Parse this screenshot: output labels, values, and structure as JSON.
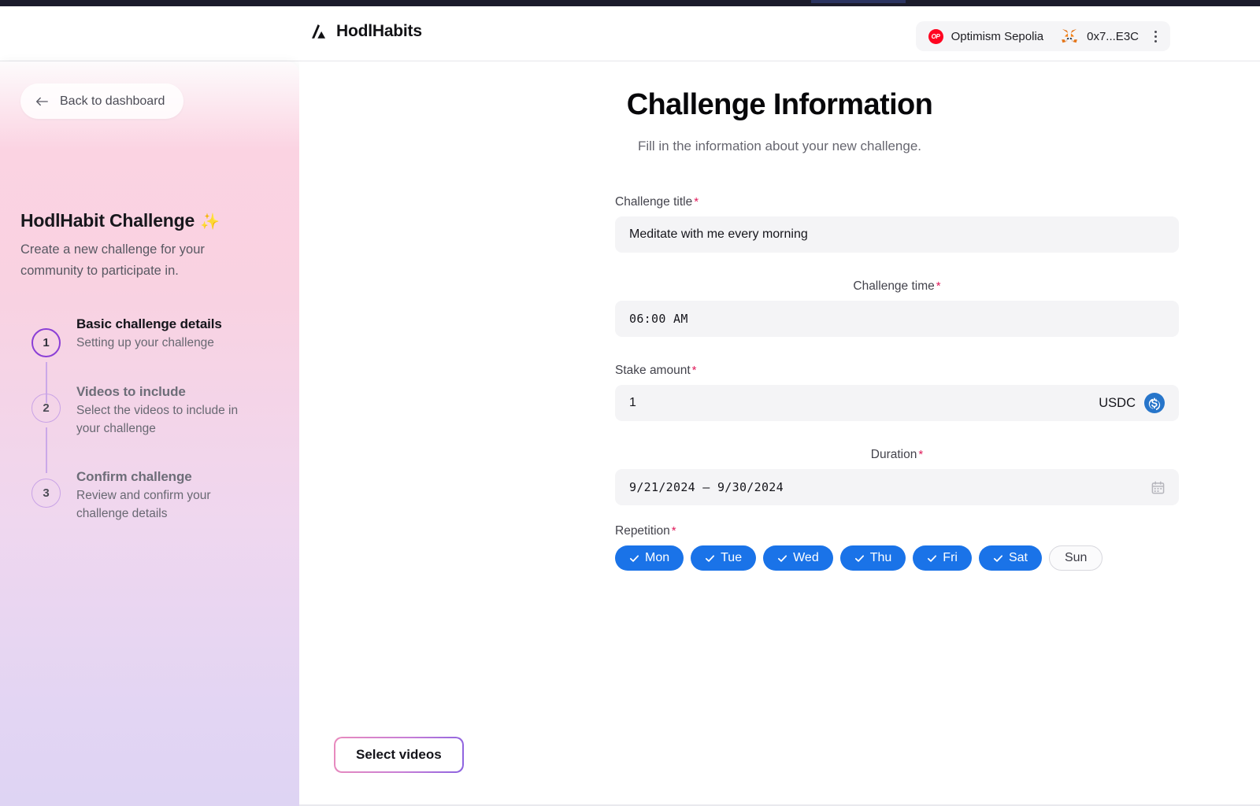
{
  "header": {
    "brand_name": "HodlHabits",
    "logo_icon": "mountain-logo-icon",
    "network_badge": "OP",
    "network_name": "Optimism Sepolia",
    "wallet_icon": "metamask-fox-icon",
    "account_address": "0x7...E3C",
    "menu_icon": "kebab-menu-icon"
  },
  "sidebar": {
    "back_button": {
      "label": "Back to dashboard",
      "icon": "arrow-left-icon"
    },
    "title": "HodlHabit Challenge",
    "title_emoji": "✨",
    "subtitle": "Create a new challenge for your community to participate in.",
    "steps": [
      {
        "number": "1",
        "title": "Basic challenge details",
        "description": "Setting up your challenge",
        "state": "active"
      },
      {
        "number": "2",
        "title": "Videos to include",
        "description": "Select the videos to include in your challenge",
        "state": "inactive"
      },
      {
        "number": "3",
        "title": "Confirm challenge",
        "description": "Review and confirm your challenge details",
        "state": "inactive"
      }
    ]
  },
  "main": {
    "title": "Challenge Information",
    "subtitle": "Fill in the information about your new challenge.",
    "required_marker": "*",
    "fields": {
      "challenge_title": {
        "label": "Challenge title",
        "value": "Meditate with me every morning"
      },
      "challenge_time": {
        "label": "Challenge time",
        "value": "06:00 AM"
      },
      "stake_amount": {
        "label": "Stake amount",
        "value": "1",
        "currency": "USDC",
        "currency_icon": "usdc-coin-icon"
      },
      "duration": {
        "label": "Duration",
        "value": "9/21/2024 – 9/30/2024",
        "icon": "calendar-icon"
      },
      "repetition": {
        "label": "Repetition",
        "days": [
          {
            "label": "Mon",
            "selected": true
          },
          {
            "label": "Tue",
            "selected": true
          },
          {
            "label": "Wed",
            "selected": true
          },
          {
            "label": "Thu",
            "selected": true
          },
          {
            "label": "Fri",
            "selected": true
          },
          {
            "label": "Sat",
            "selected": true
          },
          {
            "label": "Sun",
            "selected": false
          }
        ]
      }
    }
  },
  "footer": {
    "select_videos_label": "Select videos"
  },
  "colors": {
    "accent_blue": "#1a73e8",
    "required_red": "#e01a5a",
    "optimism_red": "#ff0420",
    "step_active_purple": "#8b3fd6",
    "step_inactive_purple": "#c9a3e6",
    "input_background": "#f4f4f6"
  }
}
